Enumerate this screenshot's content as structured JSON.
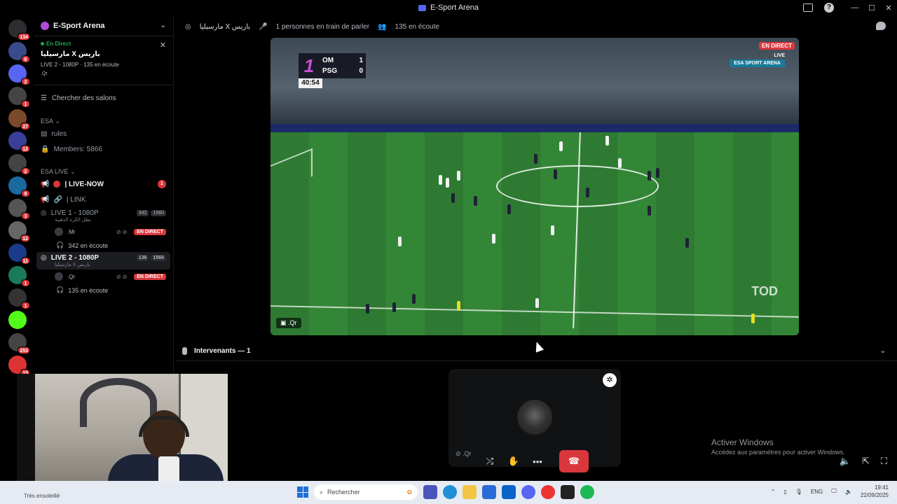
{
  "window": {
    "title": "E-Sport Arena"
  },
  "servers": [
    {
      "badge": "134",
      "color": "#2b2d31",
      "icon": "discord-home-icon"
    },
    {
      "badge": "6",
      "color": "#3b4a8a",
      "icon": "server-icon"
    },
    {
      "badge": "2",
      "color": "#5865f2",
      "icon": "discord-icon"
    },
    {
      "badge": "1",
      "color": "#444",
      "icon": "server-icon"
    },
    {
      "badge": "27",
      "color": "#7a4a2a",
      "icon": "server-icon"
    },
    {
      "badge": "12",
      "color": "#3a3f9a",
      "icon": "server-icon"
    },
    {
      "badge": "2",
      "color": "#444",
      "icon": "server-icon"
    },
    {
      "badge": "9",
      "color": "#1a6aa0",
      "icon": "server-icon"
    },
    {
      "badge": "3",
      "color": "#555",
      "icon": "server-icon"
    },
    {
      "badge": "12",
      "color": "#666",
      "icon": "server-icon"
    },
    {
      "badge": "11",
      "color": "#1a3a8a",
      "icon": "server-icon"
    },
    {
      "badge": "1",
      "color": "#1a7a5a",
      "icon": "server-icon"
    },
    {
      "badge": "1",
      "color": "#333",
      "icon": "server-icon"
    },
    {
      "badge": "",
      "color": "#53fc18",
      "icon": "kick-icon"
    },
    {
      "badge": "253",
      "color": "#444",
      "icon": "server-icon"
    },
    {
      "badge": "15",
      "color": "#d33",
      "icon": "server-icon"
    }
  ],
  "guild": {
    "name": "E-Sport Arena"
  },
  "live_card": {
    "status": "En Direct",
    "title": "مارسيليا X باريس",
    "meta": "LIVE 2 - 1080P · 135 en écoute",
    "user": ".Qr"
  },
  "search_channels": "Chercher des salons",
  "categories": {
    "esa": "ESA",
    "esa_live": "ESA LIVE"
  },
  "text_channels": {
    "rules": "rules",
    "members": "Members: 5866",
    "live_now": "| LIVE-NOW",
    "live_now_badge": "1",
    "link": "| LINK"
  },
  "voice_channels": [
    {
      "name": "LIVE 1 - 1080P",
      "subtitle": "بطل الكرة الذهبية",
      "video_count": "342",
      "limit": "1560",
      "member": ".Mr",
      "member_badge": "EN DIRECT",
      "listeners": "342 en écoute"
    },
    {
      "name": "LIVE 2 - 1080P",
      "subtitle": "مارسيليا X باريس",
      "video_count": "136",
      "limit": "1560",
      "member": ".Qr",
      "member_badge": "EN DIRECT",
      "listeners": "135 en écoute"
    }
  ],
  "topbar": {
    "channel": "مارسيليا X باريس",
    "speaking": "1 personnes en train de parler",
    "listening": "135 en écoute"
  },
  "stream": {
    "live_badge": "EN DIRECT",
    "scoreboard": {
      "period": "1",
      "team_home": "OM",
      "score_home": "1",
      "team_away": "PSG",
      "score_away": "0",
      "clock": "40:54"
    },
    "broadcaster": "LIVE",
    "broadcaster_brand": "ESA SPORT ARENA",
    "watermark": "TOD",
    "streamer": ".Qr"
  },
  "speakers_section": {
    "label": "Intervenants — 1"
  },
  "speaker_tile": {
    "name": ".Qr"
  },
  "activation": {
    "line1": "Activer Windows",
    "line2": "Accédez aux paramètres pour activer Windows."
  },
  "taskbar": {
    "weather": "Très ensoleillé",
    "search": "Rechercher",
    "lang": "ENG",
    "time": "19:41",
    "date": "22/09/2025"
  }
}
